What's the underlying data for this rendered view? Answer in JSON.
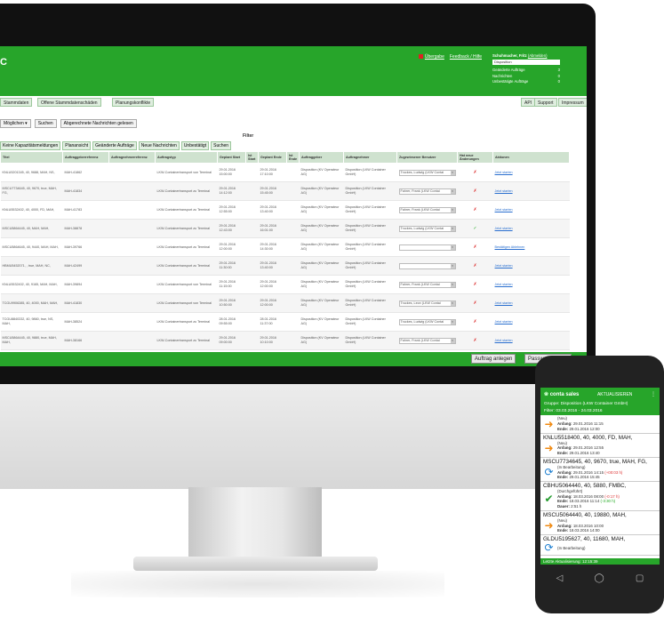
{
  "header": {
    "links": [
      "Übergabe",
      "Feedback / Hilfe"
    ],
    "user_label": "Schuhmacher, Fritz",
    "user_action": "(Abmelden)",
    "role": "Disposition",
    "counters": [
      {
        "label": "Geänderte Aufträge",
        "value": "3"
      },
      {
        "label": "Nachrichten",
        "value": "0"
      },
      {
        "label": "Unbestätigte Aufträge",
        "value": "0"
      }
    ]
  },
  "main_tabs": [
    "Stammdaten",
    "Offene Stammdatenschäden",
    "Planungskonflikte"
  ],
  "right_tabs": [
    "API",
    "Support",
    "Impressum"
  ],
  "filter": {
    "select_value": "Möglichen",
    "search_button": "Suchen",
    "mark_read_button": "Abgerechnete Nachrichten gelesen",
    "title": "Filter"
  },
  "sub_tabs": [
    "Keine Kapazitätsmeldungen",
    "Planansicht",
    "Geänderte Aufträge",
    "Neue Nachrichten",
    "Unbestätigt",
    "Suchen"
  ],
  "table": {
    "headers": [
      "Titel",
      "Auftraggeberreferenz",
      "Auftragnehmerreferenz",
      "Auftragstyp",
      "Geplant Start",
      "Ist Start",
      "Geplant Ende",
      "Ist Ende",
      "Auftraggeber",
      "Auftragnehmer",
      "Zugewiesener Benutzer",
      "Hat neue Änderungen",
      "Aktionen"
    ],
    "rows": [
      {
        "title": "KNLU5201345, 40, 9688, MAH, NS,",
        "ref": "MAH-41862",
        "type": "LKW-Containertransport von Terminal",
        "start": "29.01.2016 15:00:00",
        "end": "29.01.2016 17:10:00",
        "client": "Disposition (KV Operateur AG)",
        "contractor": "Disposition (LKW Container GmbH)",
        "user": "Truckes, Ludwig (LKW Contai",
        "changes": "✗",
        "action": "Jetzt starten"
      },
      {
        "title": "MSCU7734645, 40, 9670, true, MAH, FG,",
        "ref": "MAH-41834",
        "type": "LKW-Containertransport zu Terminal",
        "start": "29.01.2016 14:12:00",
        "end": "29.01.2016 15:45:00",
        "client": "Disposition (KV Operateur AG)",
        "contractor": "Disposition (LKW Container GmbH)",
        "user": "Fahrer, Frank (LKW Contai",
        "changes": "✗",
        "action": "Jetzt starten"
      },
      {
        "title": "KNLU5532402, 40, 4000, FD, MAH,",
        "ref": "MAH-41783",
        "type": "LKW-Containertransport zu Terminal",
        "start": "29.01.2016 12:55:00",
        "end": "29.01.2016 13:40:00",
        "client": "Disposition (KV Operateur AG)",
        "contractor": "Disposition (LKW Container GmbH)",
        "user": "Fahrer, Frank (LKW Contai",
        "changes": "✗",
        "action": "Jetzt starten"
      },
      {
        "title": "MSCU5864445, 40, MAH, MAH,",
        "ref": "MAH-38878",
        "type": "LKW-Containertransport zu Terminal",
        "start": "29.01.2016 12:43:00",
        "end": "29.01.2016 16:01:00",
        "client": "Disposition (KV Operateur AG)",
        "contractor": "Disposition (LKW Container GmbH)",
        "user": "Truckes, Ludwig (LKW Contai",
        "changes": "✓",
        "action": "Jetzt starten"
      },
      {
        "title": "MSCU5864645, 40, 9440, MAH, MAH,",
        "ref": "MAH-39766",
        "type": "LKW-Containertransport zu Terminal",
        "start": "29.01.2016 12:00:00",
        "end": "29.01.2016 14:30:00",
        "client": "Disposition (KV Operateur AG)",
        "contractor": "Disposition (LKW Container GmbH)",
        "user": "",
        "changes": "✗",
        "action": "Bestätigen Ablehnen"
      },
      {
        "title": "HBMU5452071, , true, MAH, NC,",
        "ref": "MAH-42499",
        "type": "LKW-Containertransport zu Terminal",
        "start": "29.01.2016 11:30:00",
        "end": "29.01.2016 13:40:00",
        "client": "Disposition (KV Operateur AG)",
        "contractor": "Disposition (LKW Container GmbH)",
        "user": "",
        "changes": "✗",
        "action": "Jetzt starten"
      },
      {
        "title": "KNLU5532402, 40, 9165, MAH, MAH,",
        "ref": "MAH-39894",
        "type": "LKW-Containertransport von Terminal",
        "start": "29.01.2016 11:15:00",
        "end": "29.01.2016 12:00:00",
        "client": "Disposition (KV Operateur AG)",
        "contractor": "Disposition (LKW Container GmbH)",
        "user": "Fahrer, Frank (LKW Contai",
        "changes": "✗",
        "action": "Jetzt starten"
      },
      {
        "title": "TCGU9906385, 40, 4000, MAH, MAH,",
        "ref": "MAH-41830",
        "type": "LKW-Containertransport von Terminal",
        "start": "29.01.2016 10:50:00",
        "end": "29.01.2016 12:00:00",
        "client": "Disposition (KV Operateur AG)",
        "contractor": "Disposition (LKW Container GmbH)",
        "user": "Truckes, Leon (LKW Contai",
        "changes": "✗",
        "action": "Jetzt starten"
      },
      {
        "title": "TCGU8840332, 40, 9860, true, NS, MAH,",
        "ref": "MAH-38524",
        "type": "LKW-Containertransport zu Terminal",
        "start": "28.01.2016 09:55:00",
        "end": "28.01.2016 11:37:00",
        "client": "Disposition (KV Operateur AG)",
        "contractor": "Disposition (LKW Container GmbH)",
        "user": "Truckes, Ludwig (LKW Contai",
        "changes": "✗",
        "action": "Jetzt starten"
      },
      {
        "title": "MSCU5864445, 40, 9880, true, MAH, MAH,",
        "ref": "MAH-38166",
        "type": "LKW-Containertransport zu Terminal",
        "start": "29.01.2016 09:00:00",
        "end": "29.01.2016 10:10:00",
        "client": "Disposition (KV Operateur AG)",
        "contractor": "Disposition (LKW Container GmbH)",
        "user": "Fahrer, Frank (LKW Contai",
        "changes": "✗",
        "action": "Jetzt starten"
      }
    ]
  },
  "footer": {
    "new_order_button": "Auftrag anlegen",
    "password_button": "Passwort ändern"
  },
  "phone": {
    "app_title": "conta sales",
    "refresh_label": "AKTUALISIEREN",
    "group_line": "Gruppe: Disposition (LKW Container GmbH)",
    "filter_line": "Filter: 03.03.2016 - 24.03.2016",
    "items": [
      {
        "title": "",
        "status": "(Neu)",
        "icon": "arrow-icon",
        "start_label": "Anfang:",
        "start": "29.01.2016 11:15",
        "end_label": "Ende:",
        "end": "29.01.2016 12:00",
        "delta": ""
      },
      {
        "title": "KNLU5518400, 40, 4000, FD, MAH,",
        "status": "(Neu)",
        "icon": "arrow-icon",
        "start_label": "Anfang:",
        "start": "29.01.2016 12:55",
        "end_label": "Ende:",
        "end": "29.01.2016 13:40",
        "delta": ""
      },
      {
        "title": "MSCU7734645, 40, 9670, true, MAH, FG,",
        "status": "(In Bearbeitung)",
        "icon": "sync-icon",
        "start_label": "Anfang:",
        "start": "29.01.2016 14:15",
        "end_label": "Ende:",
        "end": "29.01.2016 15:45",
        "delta": "(+00:03 h)"
      },
      {
        "title": "CBHU5064440, 40, 5880, FMBC,",
        "status": "(Durchgeführt)",
        "icon": "check-icon",
        "start_label": "Anfang:",
        "start": "18.03.2016 08:00",
        "end_label": "Ende:",
        "end": "18.03.2016 11:14",
        "delta": "(-0:17 h)",
        "delta2": "(-3:30 h)",
        "dauer_label": "Dauer:",
        "dauer": "2:51 h"
      },
      {
        "title": "MSCU5064440, 40, 19880, MAH,",
        "status": "(Neu)",
        "icon": "arrow-icon",
        "start_label": "Anfang:",
        "start": "18.03.2016 10:00",
        "end_label": "Ende:",
        "end": "18.03.2016 14:00",
        "delta": ""
      },
      {
        "title": "GLDU5195627, 40, 11680, MAH,",
        "status": "(In Bearbeitung)",
        "icon": "sync-icon",
        "start_label": "",
        "start": "",
        "end_label": "",
        "end": "",
        "delta": ""
      }
    ],
    "footer_line": "Letzte Aktualisierung: 12:15:39"
  }
}
